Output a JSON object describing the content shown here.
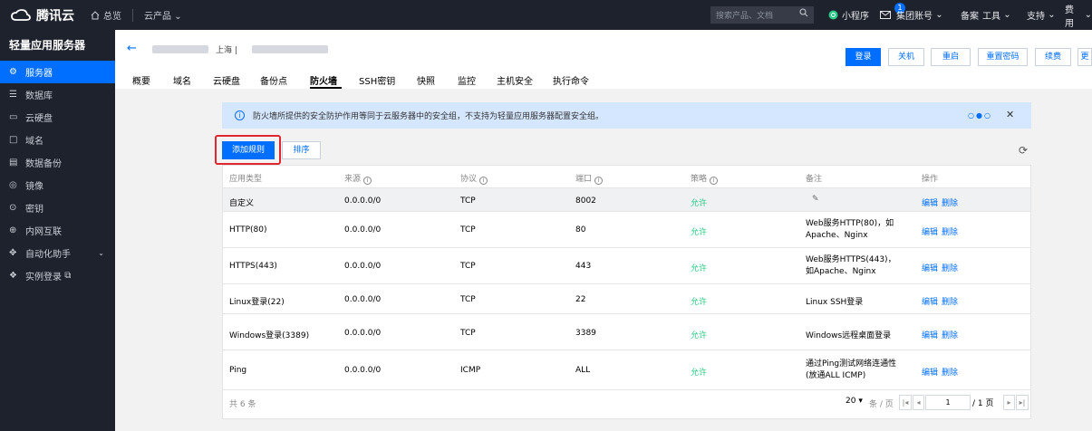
{
  "topbar": {
    "brand": "腾讯云",
    "home": "总览",
    "products": "云产品",
    "search_placeholder": "搜索产品、文档",
    "mini_program": "小程序",
    "message_badge": "1",
    "account": "集团账号",
    "filing": "备案",
    "tools": "工具",
    "support": "支持",
    "billing": "费用"
  },
  "sidebar": {
    "title": "轻量应用服务器",
    "items": [
      {
        "label": "服务器",
        "icon": "server-icon"
      },
      {
        "label": "数据库",
        "icon": "database-icon"
      },
      {
        "label": "云硬盘",
        "icon": "disk-icon"
      },
      {
        "label": "域名",
        "icon": "domain-icon"
      },
      {
        "label": "数据备份",
        "icon": "backup-icon"
      },
      {
        "label": "镜像",
        "icon": "image-icon"
      },
      {
        "label": "密钥",
        "icon": "key-icon"
      },
      {
        "label": "内网互联",
        "icon": "network-icon"
      },
      {
        "label": "自动化助手",
        "icon": "automation-icon"
      },
      {
        "label": "实例登录",
        "icon": "login-icon"
      }
    ]
  },
  "header": {
    "region": "上海 |",
    "tabs": [
      "概要",
      "域名",
      "云硬盘",
      "备份点",
      "防火墙",
      "SSH密钥",
      "快照",
      "监控",
      "主机安全",
      "执行命令"
    ],
    "active_tab": "防火墙",
    "buttons": {
      "login": "登录",
      "shutdown": "关机",
      "restart": "重启",
      "reset_password": "重置密码",
      "renew": "续费",
      "more": "更"
    }
  },
  "notice": {
    "text": "防火墙所提供的安全防护作用等同于云服务器中的安全组，不支持为轻量应用服务器配置安全组。",
    "dots": "○●○"
  },
  "actions": {
    "add_rule": "添加规则",
    "sort": "排序"
  },
  "table": {
    "headers": [
      "应用类型",
      "来源",
      "协议",
      "端口",
      "策略",
      "备注",
      "操作"
    ],
    "rows": [
      {
        "type": "自定义",
        "source": "0.0.0.0/0",
        "protocol": "TCP",
        "port": "8002",
        "policy": "允许",
        "note": "",
        "edit": "编辑",
        "delete": "删除"
      },
      {
        "type": "HTTP(80)",
        "source": "0.0.0.0/0",
        "protocol": "TCP",
        "port": "80",
        "policy": "允许",
        "note": "Web服务HTTP(80)，如Apache、Nginx",
        "edit": "编辑",
        "delete": "删除"
      },
      {
        "type": "HTTPS(443)",
        "source": "0.0.0.0/0",
        "protocol": "TCP",
        "port": "443",
        "policy": "允许",
        "note": "Web服务HTTPS(443)，如Apache、Nginx",
        "edit": "编辑",
        "delete": "删除"
      },
      {
        "type": "Linux登录(22)",
        "source": "0.0.0.0/0",
        "protocol": "TCP",
        "port": "22",
        "policy": "允许",
        "note": "Linux SSH登录",
        "edit": "编辑",
        "delete": "删除"
      },
      {
        "type": "Windows登录(3389)",
        "source": "0.0.0.0/0",
        "protocol": "TCP",
        "port": "3389",
        "policy": "允许",
        "note": "Windows远程桌面登录",
        "edit": "编辑",
        "delete": "删除"
      },
      {
        "type": "Ping",
        "source": "0.0.0.0/0",
        "protocol": "ICMP",
        "port": "ALL",
        "policy": "允许",
        "note": "通过Ping测试网络连通性(放通ALL ICMP)",
        "edit": "编辑",
        "delete": "删除"
      }
    ],
    "total": "共 6 条",
    "page_size": "20 ▾",
    "page_size_unit": "条 / 页",
    "page_input": "1",
    "page_total": "/ 1 页"
  }
}
